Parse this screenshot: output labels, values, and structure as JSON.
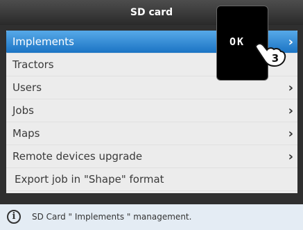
{
  "header": {
    "title": "SD card"
  },
  "menu": {
    "items": [
      {
        "label": "Implements",
        "has_arrow": true,
        "selected": true
      },
      {
        "label": "Tractors",
        "has_arrow": false,
        "selected": false
      },
      {
        "label": "Users",
        "has_arrow": true,
        "selected": false
      },
      {
        "label": "Jobs",
        "has_arrow": true,
        "selected": false
      },
      {
        "label": "Maps",
        "has_arrow": true,
        "selected": false
      },
      {
        "label": "Remote devices upgrade",
        "has_arrow": true,
        "selected": false
      },
      {
        "label": "Export job in \"Shape\" format",
        "has_arrow": false,
        "selected": false
      }
    ],
    "arrow_glyph": "›"
  },
  "ok_key": {
    "label": "OK",
    "step_number": "3"
  },
  "status": {
    "icon": "info-icon",
    "text": "SD Card \" Implements \" management."
  },
  "colors": {
    "selected_top": "#57a9e8",
    "selected_bottom": "#1b74c4",
    "frame": "#2f2f2f",
    "status_bg": "#e4ecf4"
  }
}
